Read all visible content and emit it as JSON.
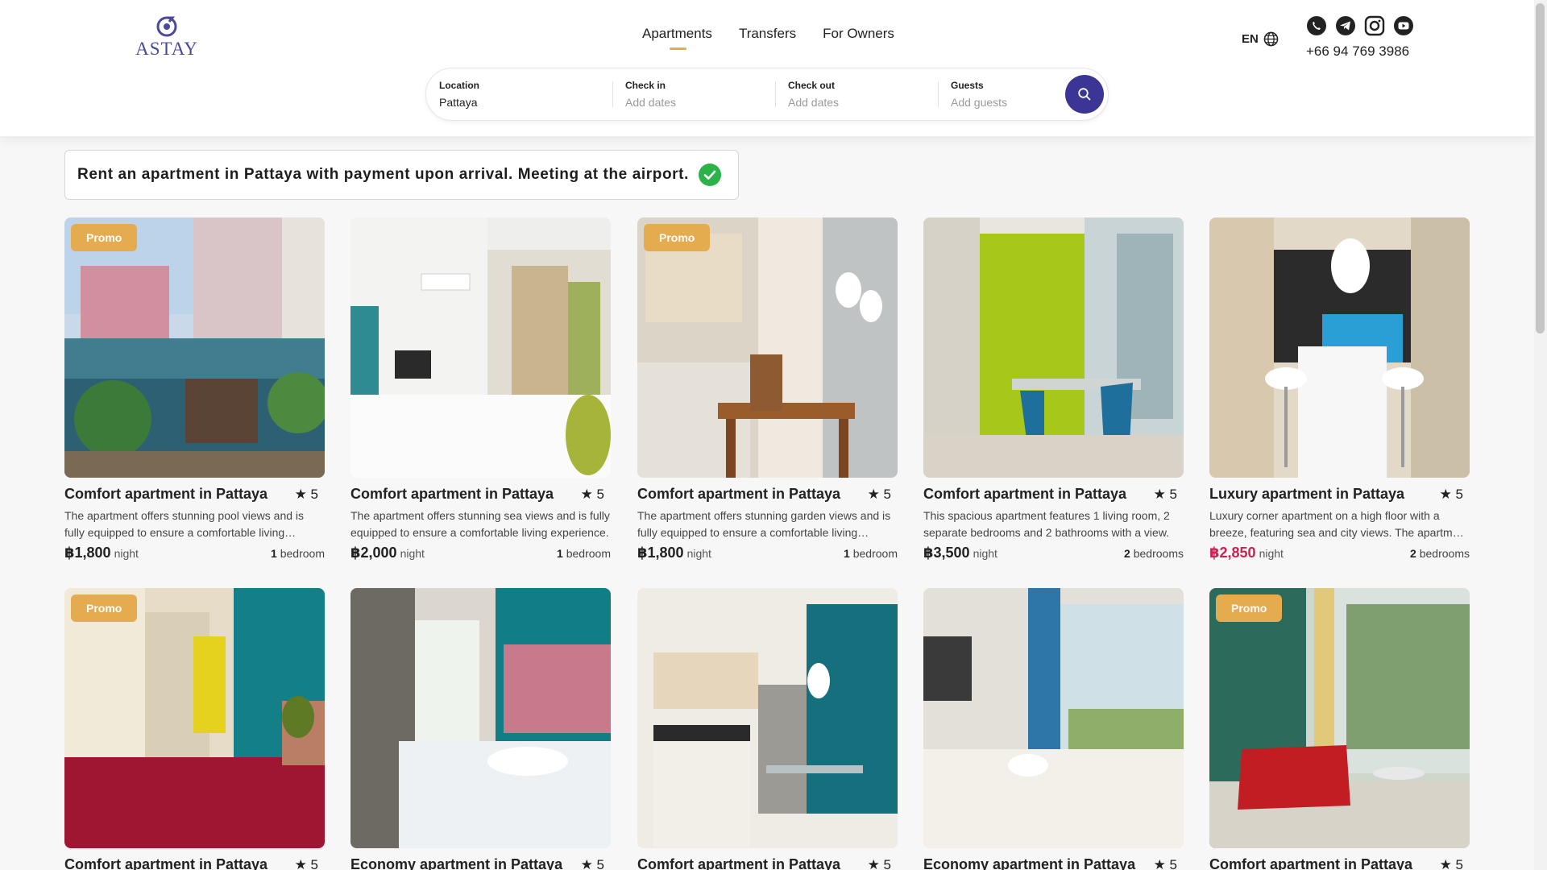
{
  "header": {
    "logo_text": "ASTAY",
    "nav": [
      {
        "label": "Apartments",
        "active": true
      },
      {
        "label": "Transfers",
        "active": false
      },
      {
        "label": "For Owners",
        "active": false
      }
    ],
    "language": "EN",
    "socials": [
      "whatsapp-icon",
      "telegram-icon",
      "instagram-icon",
      "youtube-icon"
    ],
    "phone": "+66 94 769 3986"
  },
  "search": {
    "location_label": "Location",
    "location_value": "Pattaya",
    "checkin_label": "Check in",
    "checkin_placeholder": "Add dates",
    "checkout_label": "Check out",
    "checkout_placeholder": "Add dates",
    "guests_label": "Guests",
    "guests_placeholder": "Add guests"
  },
  "banner": {
    "text": "Rent an apartment in Pattaya with payment upon arrival. Meeting at the airport."
  },
  "colors": {
    "brand": "#3b3596",
    "promo": "#e5ab4f",
    "price_highlight": "#d11f4f",
    "check": "#2bb34a"
  },
  "listings": [
    {
      "promo": "Promo",
      "title": "Comfort apartment in Pattaya",
      "rating": "★ 5",
      "desc": "The apartment offers stunning pool views and is fully equipped to ensure a comfortable living experience.",
      "price": "฿1,800",
      "night": "night",
      "bedrooms_num": "1",
      "bedrooms_word": "bedroom"
    },
    {
      "promo": "",
      "title": "Comfort apartment in Pattaya",
      "rating": "★ 5",
      "desc": "The apartment offers stunning sea views and is fully equipped to ensure a comfortable living experience.",
      "price": "฿2,000",
      "night": "night",
      "bedrooms_num": "1",
      "bedrooms_word": "bedroom"
    },
    {
      "promo": "Promo",
      "title": "Comfort apartment in Pattaya",
      "rating": "★ 5",
      "desc": "The apartment offers stunning garden views and is fully equipped to ensure a comfortable living experience.",
      "price": "฿1,800",
      "night": "night",
      "bedrooms_num": "1",
      "bedrooms_word": "bedroom"
    },
    {
      "promo": "",
      "title": "Comfort apartment in Pattaya",
      "rating": "★ 5",
      "desc": "This spacious apartment features 1 living room, 2 separate bedrooms and 2 bathrooms with a view.",
      "price": "฿3,500",
      "night": "night",
      "bedrooms_num": "2",
      "bedrooms_word": "bedrooms"
    },
    {
      "promo": "",
      "title": "Luxury apartment in Pattaya",
      "rating": "★ 5",
      "desc": "Luxury corner apartment on a high floor with a breeze, featuring sea and city views. The apartment is fully equipped.",
      "price": "฿2,850",
      "night": "night",
      "bedrooms_num": "2",
      "bedrooms_word": "bedrooms",
      "highlight": true
    },
    {
      "promo": "Promo",
      "title": "Comfort apartment in Pattaya",
      "rating": "★ 5"
    },
    {
      "promo": "",
      "title": "Economy apartment in Pattaya",
      "rating": "★ 5"
    },
    {
      "promo": "",
      "title": "Comfort apartment in Pattaya",
      "rating": "★ 5"
    },
    {
      "promo": "",
      "title": "Economy apartment in Pattaya",
      "rating": "★ 5"
    },
    {
      "promo": "Promo",
      "title": "Comfort apartment in Pattaya",
      "rating": "★ 5"
    }
  ]
}
